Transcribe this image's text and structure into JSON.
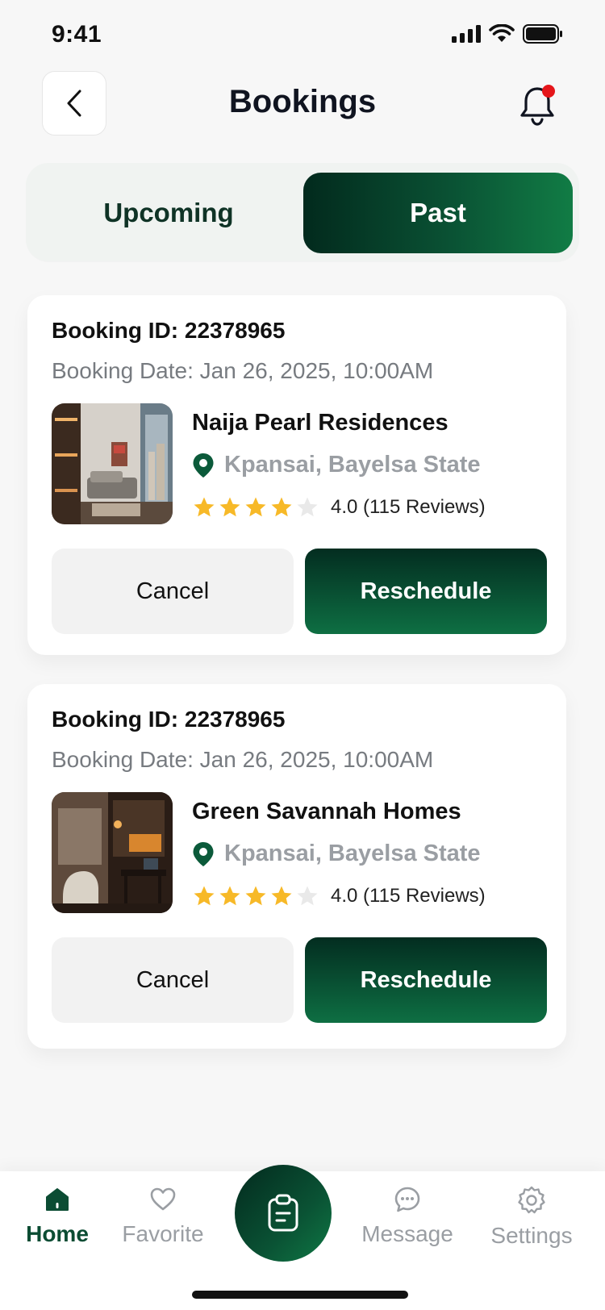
{
  "status_bar": {
    "time": "9:41"
  },
  "header": {
    "title": "Bookings"
  },
  "tabs": [
    {
      "label": "Upcoming",
      "active": false
    },
    {
      "label": "Past",
      "active": true
    }
  ],
  "bookings": [
    {
      "booking_id": "Booking ID: 22378965",
      "booking_date": "Booking Date: Jan 26, 2025, 10:00AM",
      "property_name": "Naija Pearl Residences",
      "location": "Kpansai, Bayelsa State",
      "rating": 4.0,
      "rating_text": "4.0 (115 Reviews)",
      "cancel_label": "Cancel",
      "reschedule_label": "Reschedule"
    },
    {
      "booking_id": "Booking ID: 22378965",
      "booking_date": "Booking Date: Jan 26, 2025, 10:00AM",
      "property_name": "Green Savannah Homes",
      "location": "Kpansai, Bayelsa State",
      "rating": 4.0,
      "rating_text": "4.0 (115 Reviews)",
      "cancel_label": "Cancel",
      "reschedule_label": "Reschedule"
    }
  ],
  "bottom_nav": {
    "items": [
      {
        "label": "Home",
        "icon": "home-icon",
        "active": true
      },
      {
        "label": "Favorite",
        "icon": "heart-icon",
        "active": false
      },
      {
        "label": "Message",
        "icon": "message-icon",
        "active": false
      },
      {
        "label": "Settings",
        "icon": "settings-icon",
        "active": false
      }
    ],
    "center_icon": "clipboard-icon"
  },
  "colors": {
    "brand_dark": "#022a1d",
    "brand": "#0e6f43",
    "star": "#f7b928",
    "star_empty": "#e9e9e9",
    "notification_dot": "#e5161a"
  }
}
